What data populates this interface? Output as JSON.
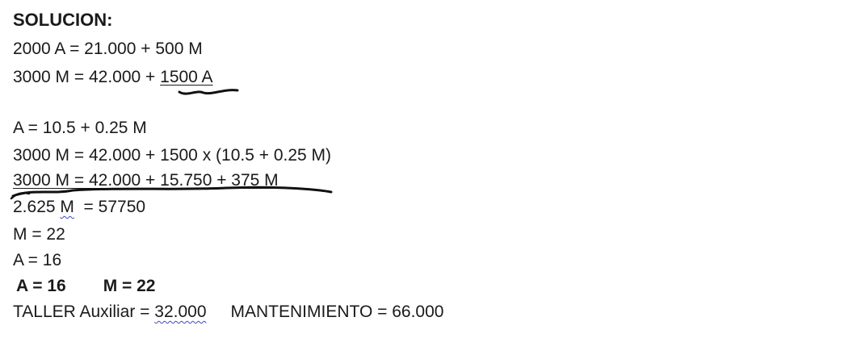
{
  "title": "SOLUCION:",
  "lines": {
    "l1": "2000 A = 21.000 + 500 M",
    "l2_prefix": "3000 M = 42.000 + ",
    "l2_underlined": "1500 A",
    "l3": "A = 10.5 + 0.25 M",
    "l4": "3000 M = 42.000 + 1500 x (10.5 + 0.25 M)",
    "l5": "3000 M = 42.000 + 15.750 + 375 M",
    "l6_a": "2.625 ",
    "l6_m": "M",
    "l6_b": "  = 57750",
    "l7": "M = 22",
    "l8": "A = 16"
  },
  "result": {
    "a": "A = 16",
    "m": "M = 22"
  },
  "final": {
    "taller_label": "TALLER Auxiliar = ",
    "taller_value": "32.000",
    "mant": "MANTENIMIENTO = 66.000"
  },
  "colors": {
    "text": "#1a1a1a",
    "ink": "#111111",
    "spellcheck": "#3b4cc0"
  }
}
